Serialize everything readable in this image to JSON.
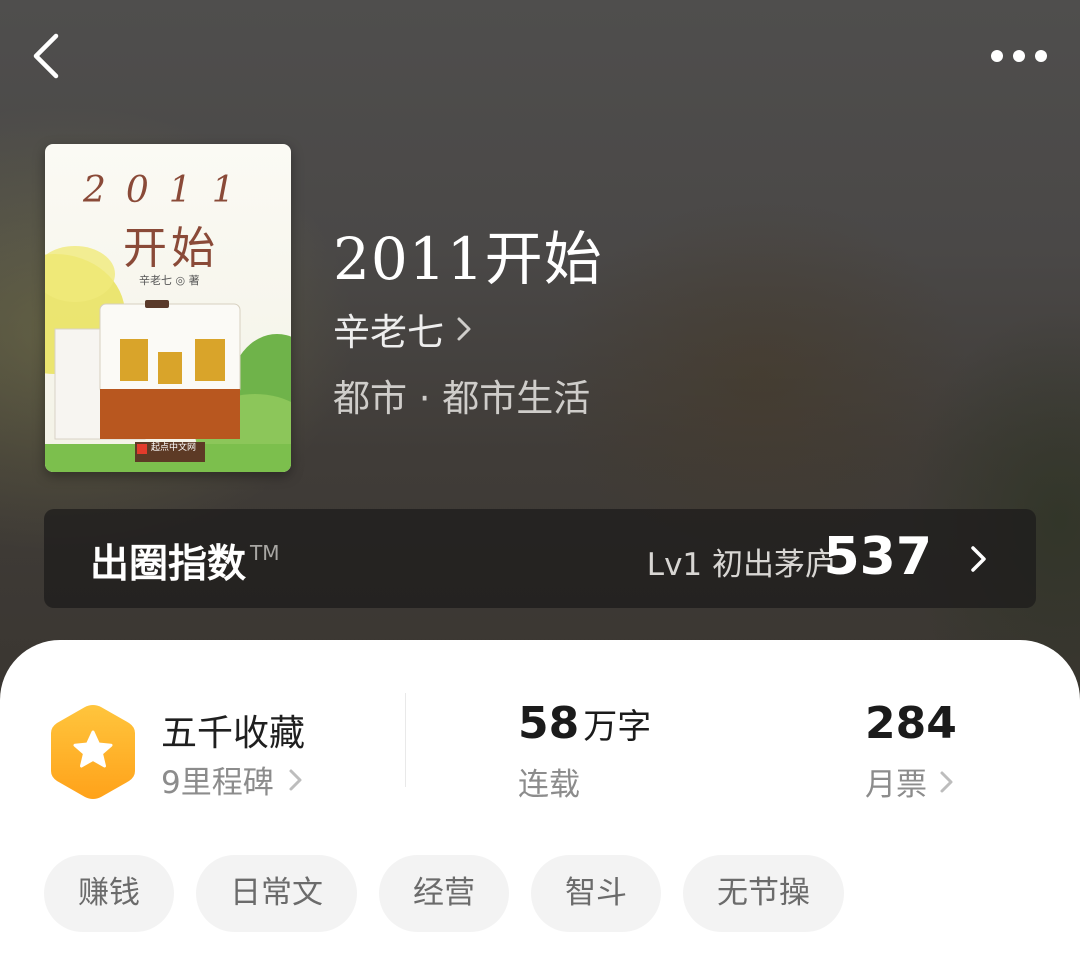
{
  "header": {
    "back_icon": "chevron-left-icon",
    "more_icon": "more-horizontal-icon"
  },
  "book": {
    "cover": {
      "title_digits": "2011",
      "title_chars": "开始",
      "author_line": "辛老七 ◎ 著",
      "publisher_mark": "起点中文网"
    },
    "title": "2011开始",
    "author": "辛老七",
    "category": "都市 · 都市生活"
  },
  "influence_index": {
    "title": "出圈指数",
    "trademark": "TM",
    "level": "Lv1 初出茅庐",
    "score": "537"
  },
  "stats": {
    "milestone": {
      "title": "五千收藏",
      "subtitle": "9里程碑",
      "icon": "star-hexagon-icon",
      "colors": {
        "hex_top": "#ffc53d",
        "hex_bottom": "#ffa21a"
      }
    },
    "words": {
      "number": "58",
      "unit": "万字",
      "status": "连载"
    },
    "monthly_tickets": {
      "number": "284",
      "label": "月票"
    }
  },
  "tags": [
    "赚钱",
    "日常文",
    "经营",
    "智斗",
    "无节操"
  ]
}
